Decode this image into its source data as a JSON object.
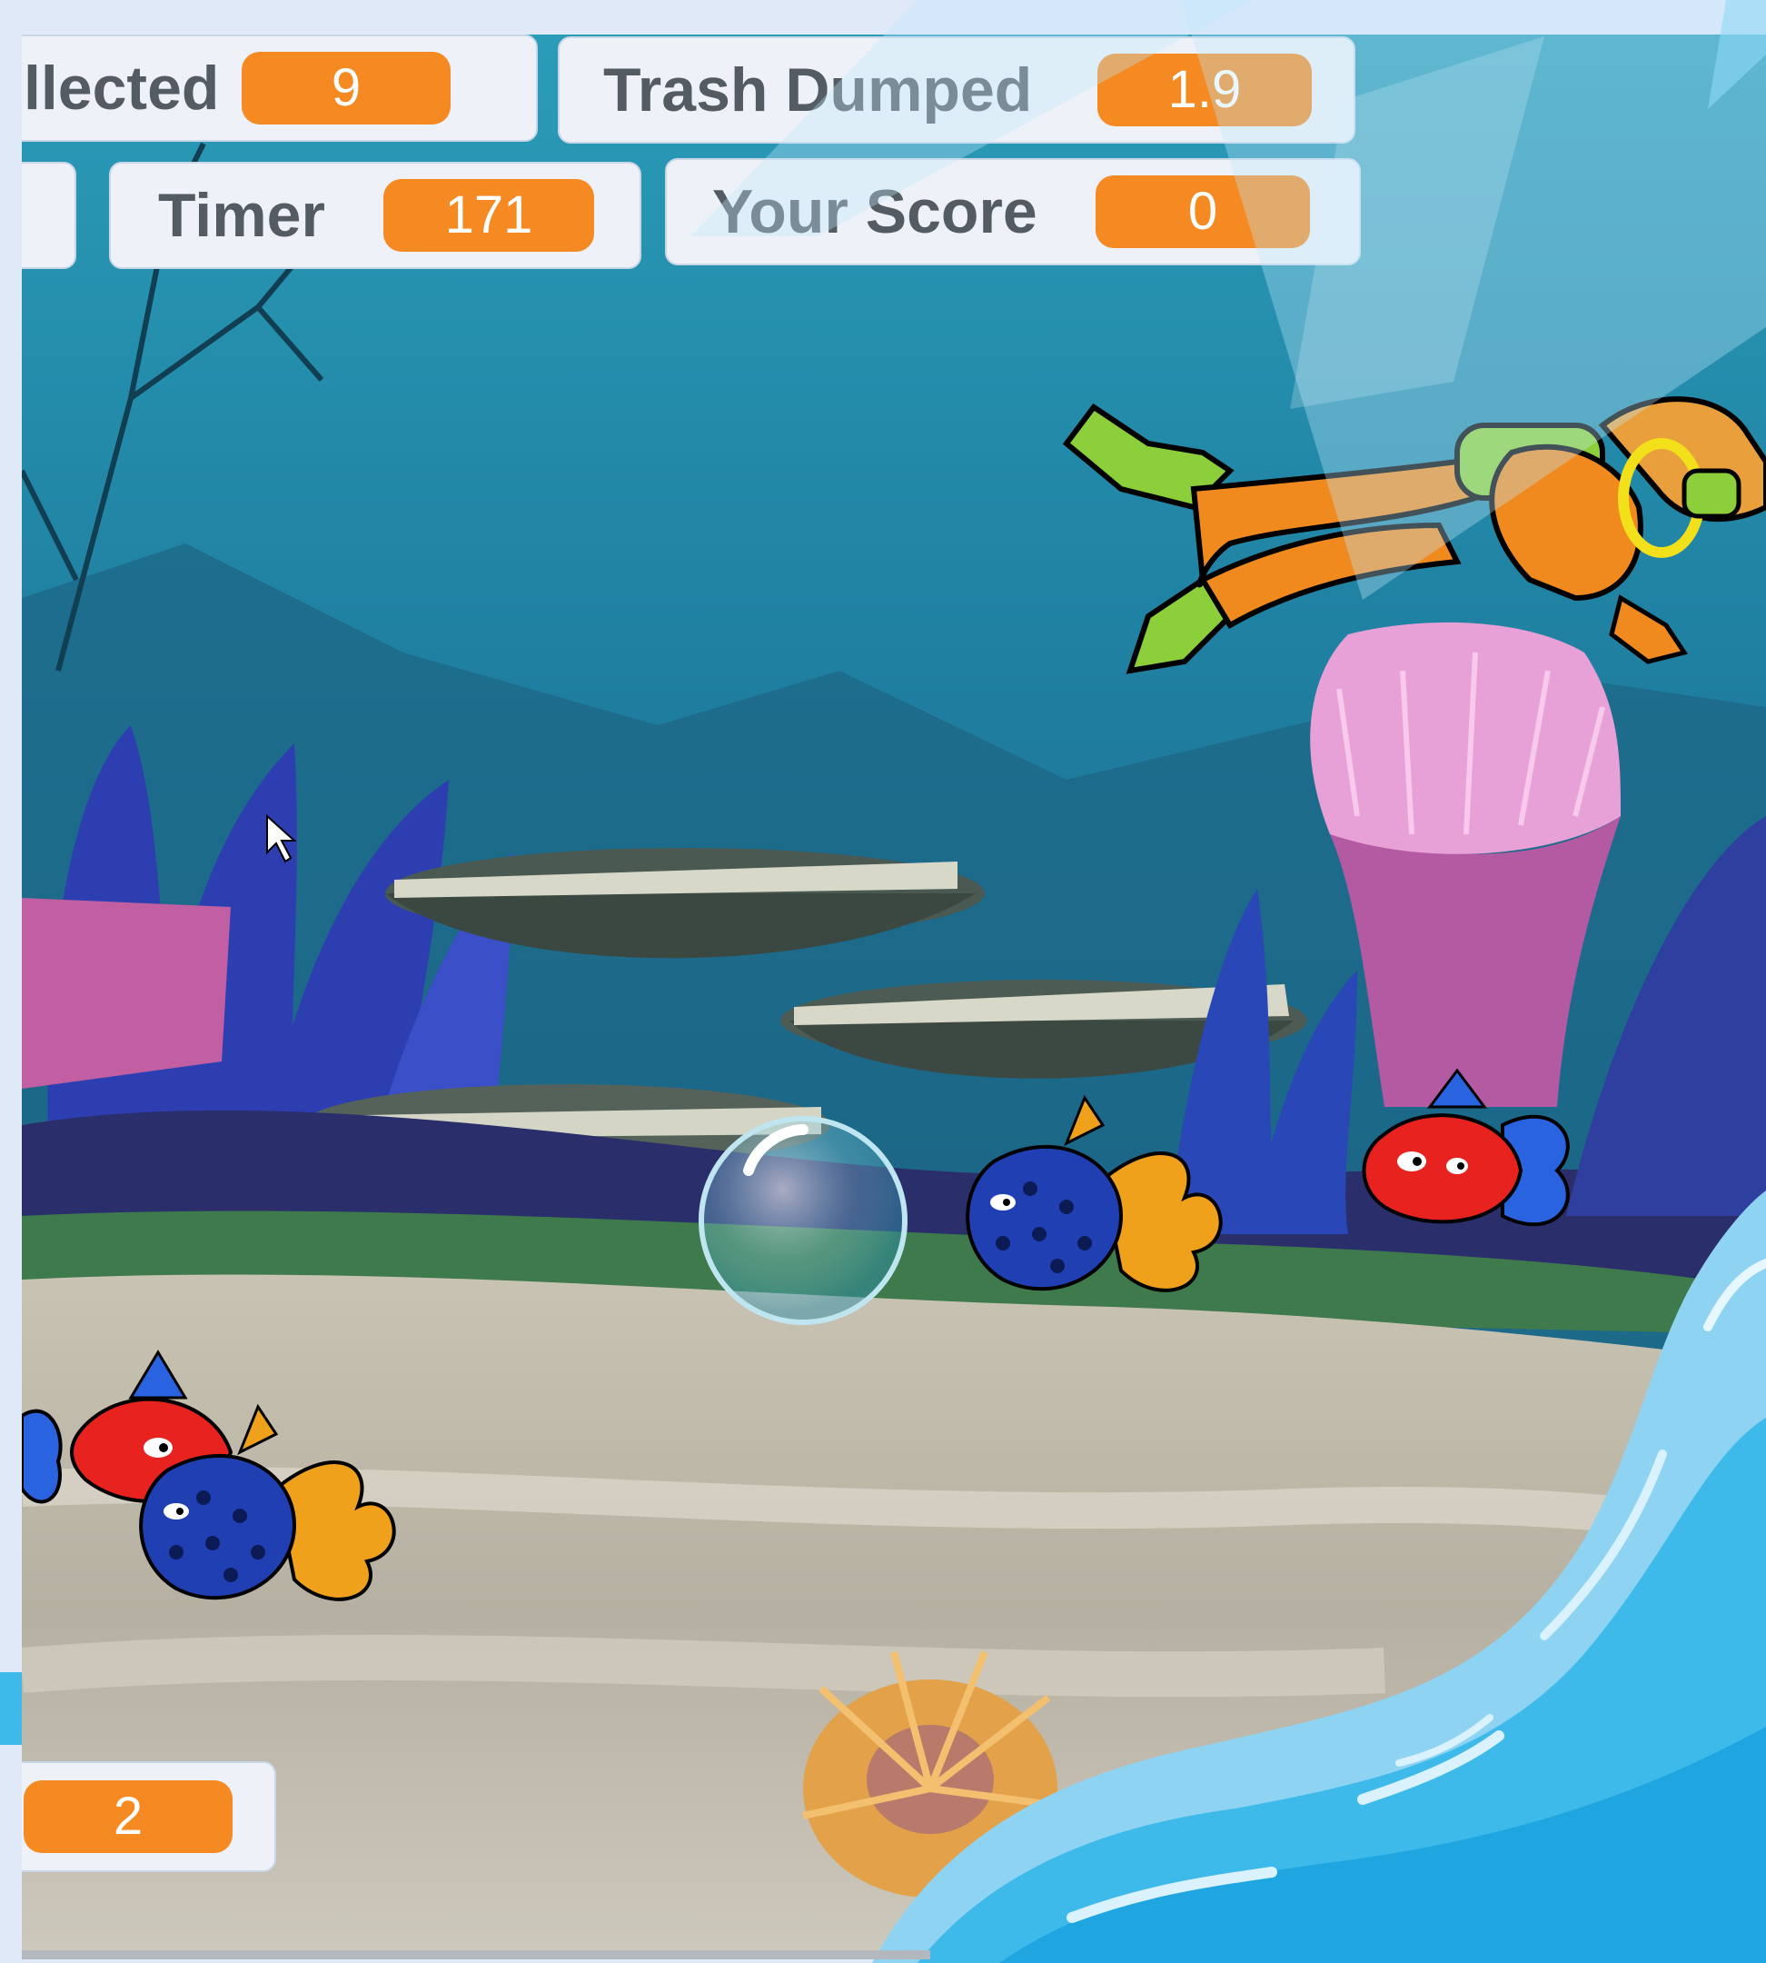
{
  "monitors": {
    "collected": {
      "label": "llected",
      "value": "9"
    },
    "trash_dumped": {
      "label": "Trash Dumped",
      "value": "1.9"
    },
    "timer": {
      "label": "Timer",
      "value": "171"
    },
    "your_score": {
      "label": "Your Score",
      "value": "0"
    },
    "unlabeled": {
      "value": "2"
    }
  },
  "colors": {
    "monitor_value": "#f58a23",
    "monitor_bg": "#eef2f8",
    "water": "#2d8fa6",
    "sand": "#c8c2b4",
    "frame_wave": "#29b6e8"
  },
  "sprites": {
    "diver": "scuba-diver",
    "bubble": "air-bubble",
    "fish": [
      "blue-spotted-fish",
      "red-fish",
      "blue-spotted-fish",
      "red-fish"
    ],
    "decor": [
      "pink-anemone",
      "orange-anemone",
      "coral-reef"
    ]
  }
}
